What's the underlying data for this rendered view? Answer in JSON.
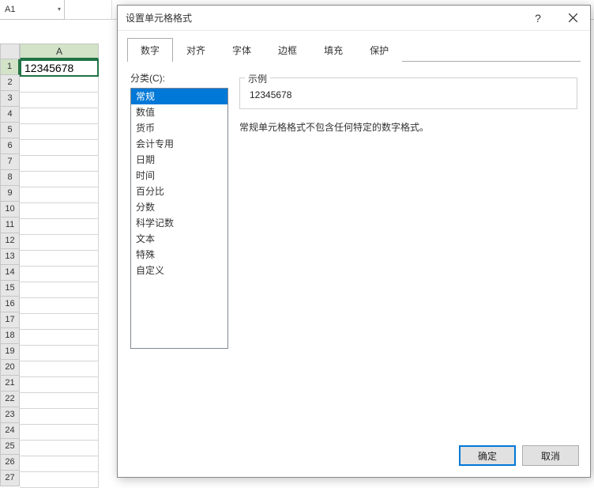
{
  "namebox": "A1",
  "col_header_a": "A",
  "rows": [
    "1",
    "2",
    "3",
    "4",
    "5",
    "6",
    "7",
    "8",
    "9",
    "10",
    "11",
    "12",
    "13",
    "14",
    "15",
    "16",
    "17",
    "18",
    "19",
    "20",
    "21",
    "22",
    "23",
    "24",
    "25",
    "26",
    "27"
  ],
  "cell_a1": "12345678",
  "dialog": {
    "title": "设置单元格格式",
    "help": "?",
    "tabs": {
      "number": "数字",
      "align": "对齐",
      "font": "字体",
      "border": "边框",
      "fill": "填充",
      "protect": "保护"
    },
    "category_label": "分类(C):",
    "categories": [
      "常规",
      "数值",
      "货币",
      "会计专用",
      "日期",
      "时间",
      "百分比",
      "分数",
      "科学记数",
      "文本",
      "特殊",
      "自定义"
    ],
    "sample_label": "示例",
    "sample_value": "12345678",
    "description": "常规单元格格式不包含任何特定的数字格式。",
    "ok": "确定",
    "cancel": "取消"
  }
}
